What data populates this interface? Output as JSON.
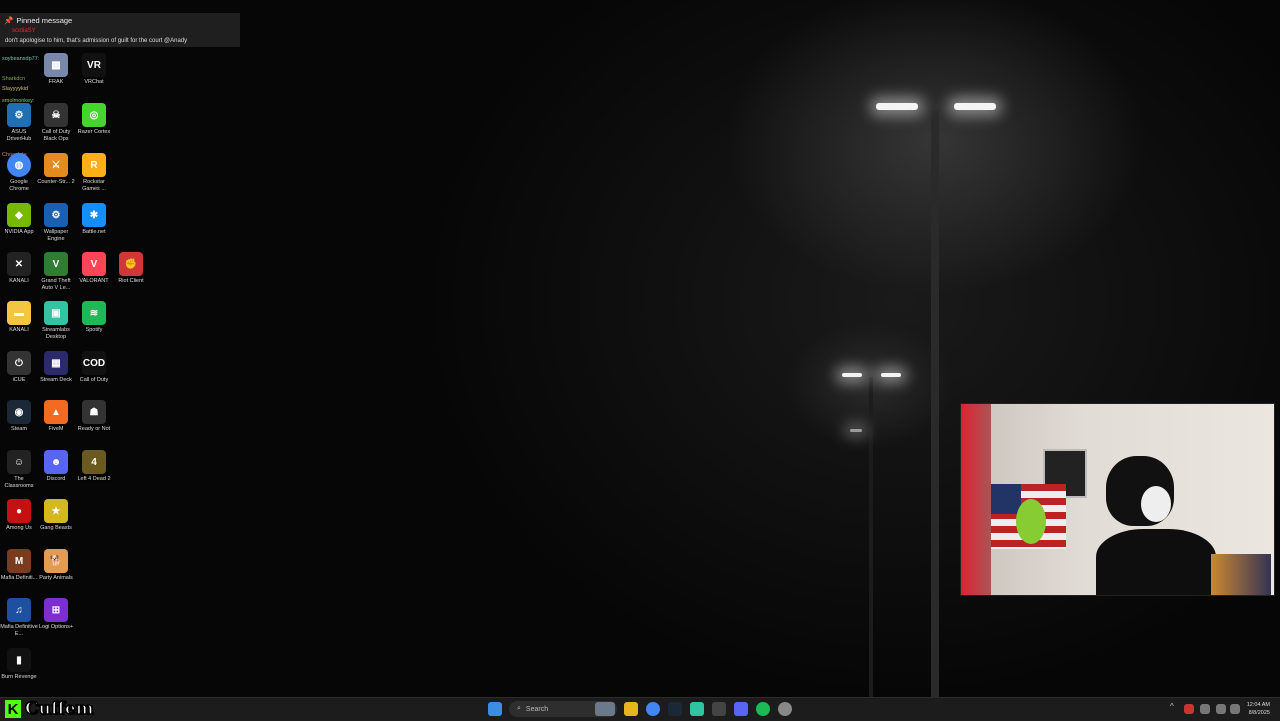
{
  "pinned": {
    "title": "Pinned message",
    "user": "scotiaSY",
    "message": "don't apologise to him, that's admission of guilt for the court @Anady"
  },
  "chat_overlay": [
    "soybeansdp77:",
    "Sharkdcn",
    "Chocolate",
    "Slayyyykid",
    "smolmonkey:"
  ],
  "desktop_icons": [
    {
      "label": "VRChat",
      "color": "#111",
      "glyph": "VR"
    },
    {
      "label": "Razer Cortex",
      "color": "#44d62c",
      "glyph": "◎"
    },
    {
      "label": "Rockstar Games ...",
      "color": "#fcaf17",
      "glyph": "R"
    },
    {
      "label": "NVIDIA App",
      "color": "#76b900",
      "glyph": "◆"
    },
    {
      "label": "Wallpaper Engine",
      "color": "#1a5fb4",
      "glyph": "⚙"
    },
    {
      "label": "Battle.net",
      "color": "#148eff",
      "glyph": "✱"
    },
    {
      "label": "KANALI",
      "color": "#222",
      "glyph": "✕"
    },
    {
      "label": "Grand Theft Auto V Le...",
      "color": "#2e7d32",
      "glyph": "V"
    },
    {
      "label": "VALORANT",
      "color": "#fd4556",
      "glyph": "V"
    },
    {
      "label": "Riot Client",
      "color": "#d13639",
      "glyph": "✊"
    },
    {
      "label": "KANALI",
      "color": "#f4c542",
      "glyph": "▬"
    },
    {
      "label": "Streamlabs Desktop",
      "color": "#31c3a2",
      "glyph": "▣"
    },
    {
      "label": "Spotify",
      "color": "#1db954",
      "glyph": "≋"
    },
    {
      "label": "iCUE",
      "color": "#333",
      "glyph": "⏻"
    },
    {
      "label": "Stream Deck",
      "color": "#2b2b6b",
      "glyph": "▦"
    },
    {
      "label": "Call of Duty",
      "color": "#111",
      "glyph": "COD"
    },
    {
      "label": "Steam",
      "color": "#1b2838",
      "glyph": "◉"
    },
    {
      "label": "FiveM",
      "color": "#f26b21",
      "glyph": "▲"
    },
    {
      "label": "Ready or Not",
      "color": "#333",
      "glyph": "☗"
    },
    {
      "label": "The Classrooms",
      "color": "#222",
      "glyph": "☺"
    },
    {
      "label": "Discord",
      "color": "#5865f2",
      "glyph": "☻"
    },
    {
      "label": "Left 4 Dead 2",
      "color": "#6b5a1e",
      "glyph": "4"
    },
    {
      "label": "Among Us",
      "color": "#c51111",
      "glyph": "●"
    },
    {
      "label": "Gang Beasts",
      "color": "#d4b81e",
      "glyph": "★"
    },
    {
      "label": "Mafia Definiti...",
      "color": "#7a3b1e",
      "glyph": "M"
    },
    {
      "label": "Party Animals",
      "color": "#e39b52",
      "glyph": "🐕"
    },
    {
      "label": "Mafia Definitive E...",
      "color": "#1e4fa0",
      "glyph": "♫"
    },
    {
      "label": "Logi Options+",
      "color": "#7b2fd1",
      "glyph": "⊞"
    },
    {
      "label": "Burn Revenge",
      "color": "#111",
      "glyph": "▮"
    }
  ],
  "partial_icons": [
    {
      "label": "Call of Duty Black Ops",
      "color": "#333",
      "glyph": "☠"
    },
    {
      "label": "Counter-Str... 2",
      "color": "#e38b1e",
      "glyph": "⚔"
    },
    {
      "label": "Google Chrome",
      "color": "#4285f4",
      "glyph": "◍"
    },
    {
      "label": "ASUS DriverHub",
      "color": "#1f6fb5",
      "glyph": "⚙"
    },
    {
      "label": "FRAK",
      "color": "#7788aa",
      "glyph": "▩"
    }
  ],
  "taskbar": {
    "search_placeholder": "Search",
    "time": "12:04 AM",
    "date": "8/8/2025"
  },
  "brand": {
    "letter": "K",
    "name": "Cuffem",
    "color": "#53fc18"
  }
}
